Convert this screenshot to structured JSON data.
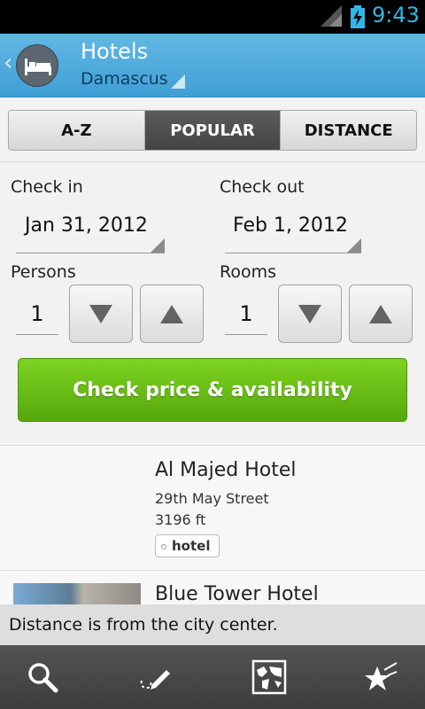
{
  "status_bar": {
    "time": "9:43",
    "signal_icon": "signal-icon",
    "battery_icon": "battery-charging-icon"
  },
  "action_bar": {
    "title": "Hotels",
    "subtitle": "Damascus",
    "app_icon": "bed-icon",
    "back_icon": "chevron-left-icon"
  },
  "sort_tabs": [
    {
      "label": "A-Z",
      "active": false
    },
    {
      "label": "POPULAR",
      "active": true
    },
    {
      "label": "DISTANCE",
      "active": false
    }
  ],
  "booking": {
    "check_in_label": "Check in",
    "check_in_value": "Jan 31, 2012",
    "check_out_label": "Check out",
    "check_out_value": "Feb 1, 2012",
    "persons_label": "Persons",
    "persons_value": "1",
    "rooms_label": "Rooms",
    "rooms_value": "1",
    "check_button": "Check price & availability"
  },
  "hotels": [
    {
      "name": "Al Majed Hotel",
      "address": "29th May Street",
      "distance": "3196 ft",
      "tag": "hotel"
    },
    {
      "name": "Blue Tower Hotel"
    }
  ],
  "toast": "Distance is from the city center.",
  "bottom_bar": {
    "icons": [
      "search-icon",
      "edit-icon",
      "map-icon",
      "favorites-icon"
    ]
  },
  "colors": {
    "accent": "#3f9fd5",
    "button_green": "#6cc11a",
    "status_time": "#33b5e5"
  }
}
